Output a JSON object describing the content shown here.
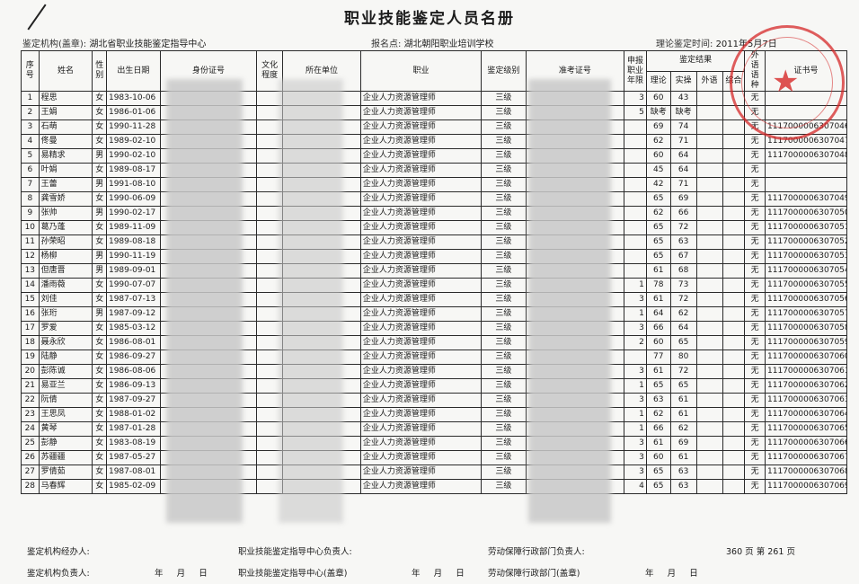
{
  "title": "职业技能鉴定人员名册",
  "header": {
    "org_label": "鉴定机构(盖章):",
    "org_value": "湖北省职业技能鉴定指导中心",
    "site_label": "报名点:",
    "site_value": "湖北朝阳职业培训学校",
    "exam_time_label": "理论鉴定时间:",
    "exam_time_value": "2011年5月7日"
  },
  "columns": {
    "seq": "序号",
    "name": "姓名",
    "gender": "性别",
    "dob": "出生日期",
    "id": "身份证号",
    "edu": "文化程度",
    "unit": "所在单位",
    "occupation": "职业",
    "level": "鉴定级别",
    "ticket": "准考证号",
    "years": "申报职业年限",
    "results": "鉴定结果",
    "theory": "理论",
    "practice": "实操",
    "language": "外语",
    "comprehensive": "综合",
    "language_type": "外语语种",
    "cert": "证书号"
  },
  "rows": [
    {
      "seq": "1",
      "name": "程思",
      "gender": "女",
      "dob": "1983-10-06",
      "occ": "企业人力资源管理师",
      "level": "三级",
      "years": "3",
      "theory": "60",
      "practice": "43",
      "lang_type": "无",
      "cert": ""
    },
    {
      "seq": "2",
      "name": "王娟",
      "gender": "女",
      "dob": "1986-01-06",
      "occ": "企业人力资源管理师",
      "level": "三级",
      "years": "5",
      "theory": "缺考",
      "practice": "缺考",
      "lang_type": "无",
      "cert": ""
    },
    {
      "seq": "3",
      "name": "石萌",
      "gender": "女",
      "dob": "1990-11-28",
      "occ": "企业人力资源管理师",
      "level": "三级",
      "years": "",
      "theory": "69",
      "practice": "74",
      "lang_type": "无",
      "cert": "1117000006307046"
    },
    {
      "seq": "4",
      "name": "佟曼",
      "gender": "女",
      "dob": "1989-02-10",
      "occ": "企业人力资源管理师",
      "level": "三级",
      "years": "",
      "theory": "62",
      "practice": "71",
      "lang_type": "无",
      "cert": "1117000006307047"
    },
    {
      "seq": "5",
      "name": "易精求",
      "gender": "男",
      "dob": "1990-02-10",
      "occ": "企业人力资源管理师",
      "level": "三级",
      "years": "",
      "theory": "60",
      "practice": "64",
      "lang_type": "无",
      "cert": "1117000006307048"
    },
    {
      "seq": "6",
      "name": "叶娟",
      "gender": "女",
      "dob": "1989-08-17",
      "occ": "企业人力资源管理师",
      "level": "三级",
      "years": "",
      "theory": "45",
      "practice": "64",
      "lang_type": "无",
      "cert": ""
    },
    {
      "seq": "7",
      "name": "王蕾",
      "gender": "男",
      "dob": "1991-08-10",
      "occ": "企业人力资源管理师",
      "level": "三级",
      "years": "",
      "theory": "42",
      "practice": "71",
      "lang_type": "无",
      "cert": ""
    },
    {
      "seq": "8",
      "name": "龚雪娇",
      "gender": "女",
      "dob": "1990-06-09",
      "occ": "企业人力资源管理师",
      "level": "三级",
      "years": "",
      "theory": "65",
      "practice": "69",
      "lang_type": "无",
      "cert": "1117000006307049"
    },
    {
      "seq": "9",
      "name": "张帅",
      "gender": "男",
      "dob": "1990-02-17",
      "occ": "企业人力资源管理师",
      "level": "三级",
      "years": "",
      "theory": "62",
      "practice": "66",
      "lang_type": "无",
      "cert": "1117000006307050"
    },
    {
      "seq": "10",
      "name": "葛乃蓬",
      "gender": "女",
      "dob": "1989-11-09",
      "occ": "企业人力资源管理师",
      "level": "三级",
      "years": "",
      "theory": "65",
      "practice": "72",
      "lang_type": "无",
      "cert": "1117000006307051"
    },
    {
      "seq": "11",
      "name": "孙荣昭",
      "gender": "女",
      "dob": "1989-08-18",
      "occ": "企业人力资源管理师",
      "level": "三级",
      "years": "",
      "theory": "65",
      "practice": "63",
      "lang_type": "无",
      "cert": "1117000006307052"
    },
    {
      "seq": "12",
      "name": "杨柳",
      "gender": "男",
      "dob": "1990-11-19",
      "occ": "企业人力资源管理师",
      "level": "三级",
      "years": "",
      "theory": "65",
      "practice": "67",
      "lang_type": "无",
      "cert": "1117000006307053"
    },
    {
      "seq": "13",
      "name": "但唐晋",
      "gender": "男",
      "dob": "1989-09-01",
      "occ": "企业人力资源管理师",
      "level": "三级",
      "years": "",
      "theory": "61",
      "practice": "68",
      "lang_type": "无",
      "cert": "1117000006307054"
    },
    {
      "seq": "14",
      "name": "潘雨薇",
      "gender": "女",
      "dob": "1990-07-07",
      "occ": "企业人力资源管理师",
      "level": "三级",
      "years": "1",
      "theory": "78",
      "practice": "73",
      "lang_type": "无",
      "cert": "1117000006307055"
    },
    {
      "seq": "15",
      "name": "刘佳",
      "gender": "女",
      "dob": "1987-07-13",
      "occ": "企业人力资源管理师",
      "level": "三级",
      "years": "3",
      "theory": "61",
      "practice": "72",
      "lang_type": "无",
      "cert": "1117000006307056"
    },
    {
      "seq": "16",
      "name": "张珩",
      "gender": "男",
      "dob": "1987-09-12",
      "occ": "企业人力资源管理师",
      "level": "三级",
      "years": "1",
      "theory": "64",
      "practice": "62",
      "lang_type": "无",
      "cert": "1117000006307057"
    },
    {
      "seq": "17",
      "name": "罗爱",
      "gender": "女",
      "dob": "1985-03-12",
      "occ": "企业人力资源管理师",
      "level": "三级",
      "years": "3",
      "theory": "66",
      "practice": "64",
      "lang_type": "无",
      "cert": "1117000006307058"
    },
    {
      "seq": "18",
      "name": "聂永欣",
      "gender": "女",
      "dob": "1986-08-01",
      "occ": "企业人力资源管理师",
      "level": "三级",
      "years": "2",
      "theory": "60",
      "practice": "65",
      "lang_type": "无",
      "cert": "1117000006307059"
    },
    {
      "seq": "19",
      "name": "陆静",
      "gender": "女",
      "dob": "1986-09-27",
      "occ": "企业人力资源管理师",
      "level": "三级",
      "years": "",
      "theory": "77",
      "practice": "80",
      "lang_type": "无",
      "cert": "1117000006307060"
    },
    {
      "seq": "20",
      "name": "彭陈诚",
      "gender": "女",
      "dob": "1986-08-06",
      "occ": "企业人力资源管理师",
      "level": "三级",
      "years": "3",
      "theory": "61",
      "practice": "72",
      "lang_type": "无",
      "cert": "1117000006307061"
    },
    {
      "seq": "21",
      "name": "易亚兰",
      "gender": "女",
      "dob": "1986-09-13",
      "occ": "企业人力资源管理师",
      "level": "三级",
      "years": "1",
      "theory": "65",
      "practice": "65",
      "lang_type": "无",
      "cert": "1117000006307062"
    },
    {
      "seq": "22",
      "name": "阮倩",
      "gender": "女",
      "dob": "1987-09-27",
      "occ": "企业人力资源管理师",
      "level": "三级",
      "years": "3",
      "theory": "63",
      "practice": "61",
      "lang_type": "无",
      "cert": "1117000006307063"
    },
    {
      "seq": "23",
      "name": "王思凤",
      "gender": "女",
      "dob": "1988-01-02",
      "occ": "企业人力资源管理师",
      "level": "三级",
      "years": "1",
      "theory": "62",
      "practice": "61",
      "lang_type": "无",
      "cert": "1117000006307064"
    },
    {
      "seq": "24",
      "name": "黄琴",
      "gender": "女",
      "dob": "1987-01-28",
      "occ": "企业人力资源管理师",
      "level": "三级",
      "years": "1",
      "theory": "66",
      "practice": "62",
      "lang_type": "无",
      "cert": "1117000006307065"
    },
    {
      "seq": "25",
      "name": "彭静",
      "gender": "女",
      "dob": "1983-08-19",
      "occ": "企业人力资源管理师",
      "level": "三级",
      "years": "3",
      "theory": "61",
      "practice": "69",
      "lang_type": "无",
      "cert": "1117000006307066"
    },
    {
      "seq": "26",
      "name": "苏疆疆",
      "gender": "女",
      "dob": "1987-05-27",
      "occ": "企业人力资源管理师",
      "level": "三级",
      "years": "3",
      "theory": "60",
      "practice": "61",
      "lang_type": "无",
      "cert": "1117000006307067"
    },
    {
      "seq": "27",
      "name": "罗倩茹",
      "gender": "女",
      "dob": "1987-08-01",
      "occ": "企业人力资源管理师",
      "level": "三级",
      "years": "3",
      "theory": "65",
      "practice": "63",
      "lang_type": "无",
      "cert": "1117000006307068"
    },
    {
      "seq": "28",
      "name": "马春辉",
      "gender": "女",
      "dob": "1985-02-09",
      "occ": "企业人力资源管理师",
      "level": "三级",
      "years": "4",
      "theory": "65",
      "practice": "63",
      "lang_type": "无",
      "cert": "1117000006307069"
    }
  ],
  "footer": {
    "agent_label": "鉴定机构经办人:",
    "center_head_label": "职业技能鉴定指导中心负责人:",
    "labor_head_label": "劳动保障行政部门负责人:",
    "pages_total": "360",
    "pages_unit": "页",
    "page_prefix": "第",
    "page_no": "261",
    "page_suffix": "页",
    "org_head_label": "鉴定机构负责人:",
    "date_y": "年",
    "date_m": "月",
    "date_d": "日",
    "center_seal_label": "职业技能鉴定指导中心(盖章)",
    "labor_seal_label": "劳动保障行政部门(盖章)"
  },
  "seal_text": "湖北朝阳职业技能鉴定指导中心"
}
